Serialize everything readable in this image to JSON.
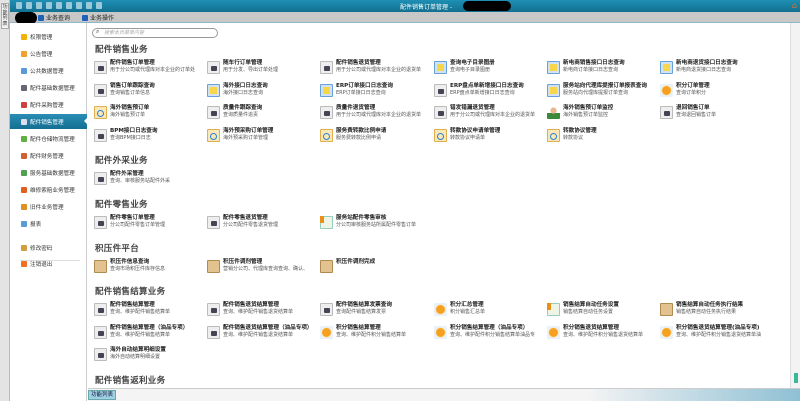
{
  "window": {
    "title": "配件销售订单管理 -",
    "left_strip_label": "功能列表"
  },
  "tabs": [
    "业务查询",
    "业务操作"
  ],
  "sidebar": {
    "items": [
      {
        "label": "权限管理",
        "color": "#f0b400"
      },
      {
        "label": "公告管理",
        "color": "#f0a030"
      },
      {
        "label": "公共数据管理",
        "color": "#5a9ad8"
      },
      {
        "label": "配件基础数据管理",
        "color": "#667"
      },
      {
        "label": "配件采购管理",
        "color": "#d04040"
      },
      {
        "label": "配件销售管理",
        "color": "#dde"
      },
      {
        "label": "配件仓储物流管理",
        "color": "#60b040"
      },
      {
        "label": "配件财务管理",
        "color": "#d06030"
      },
      {
        "label": "服务基础数据管理",
        "color": "#50a050"
      },
      {
        "label": "维修索赔业务管理",
        "color": "#e06020"
      },
      {
        "label": "旧件业务管理",
        "color": "#e09020"
      },
      {
        "label": "报表",
        "color": "#5a9ad8"
      }
    ],
    "footer": [
      {
        "label": "修改密码",
        "color": "#d0a040"
      },
      {
        "label": "注销退出",
        "color": "#f07020"
      }
    ]
  },
  "search": {
    "placeholder": "搜索本页菜单内容"
  },
  "sections": [
    {
      "title": "配件销售业务",
      "items": [
        {
          "t": "配件销售订单管理",
          "d": "用于分公司或代理库对本企业的订单处",
          "i": "doc"
        },
        {
          "t": "随车行订单管理",
          "d": "用于分发、导出订单处理",
          "i": "doc"
        },
        {
          "t": "配件销售退货管理",
          "d": "用于分公司或代理库对本企业的退货单",
          "i": "doc"
        },
        {
          "t": "查询电子目录图册",
          "d": "查询电子目录图册",
          "i": "win"
        },
        {
          "t": "新电商销售接口日志查询",
          "d": "新电商订单接口日志查询",
          "i": "win"
        },
        {
          "t": "新电商退货接口日志查询",
          "d": "新电商退货接口日志查询",
          "i": "win"
        },
        {
          "t": "销售订单跟踪查询",
          "d": "查询销售订单信息",
          "i": "doc"
        },
        {
          "t": "海外接口日志查询",
          "d": "海外接口日志查询",
          "i": "win"
        },
        {
          "t": "ERP订单接口日志查询",
          "d": "ERP订单接口日志查询",
          "i": "win"
        },
        {
          "t": "ERP盘点单新增接口日志查询",
          "d": "ERP盘点单新增接口日志查询",
          "i": "doc"
        },
        {
          "t": "服务站向代理库提报订单报表查询",
          "d": "服务站向代理库提报订单查询",
          "i": "win"
        },
        {
          "t": "积分订单管理",
          "d": "查询订单积分",
          "i": "badge"
        },
        {
          "t": "海外销售预订单",
          "d": "海外销售预订单",
          "i": "mail"
        },
        {
          "t": "质量件跟踪查询",
          "d": "查询质量件追责",
          "i": "doc"
        },
        {
          "t": "质量件退货管理",
          "d": "用于分公司或代理库对本企业的退货单",
          "i": "doc"
        },
        {
          "t": "错发错漏退货管理",
          "d": "用于分公司或代理库对本企业的退货单",
          "i": "doc"
        },
        {
          "t": "海外销售预订单监控",
          "d": "海外销售预订单监控",
          "i": "user"
        },
        {
          "t": "退回销售订单",
          "d": "查询退回销售订单",
          "i": "doc"
        },
        {
          "t": "BPM接口日志查询",
          "d": "查询BPM接口日志",
          "i": "doc"
        },
        {
          "t": "海外预采购订单管理",
          "d": "海外预采购订单管理",
          "i": "mail"
        },
        {
          "t": "服务费转款比例申请",
          "d": "服务费转款比例申请",
          "i": "mail"
        },
        {
          "t": "转款协议申请单管理",
          "d": "转款协议申请单",
          "i": "mail"
        },
        {
          "t": "转款协议管理",
          "d": "转款协议",
          "i": "mail"
        }
      ]
    },
    {
      "title": "配件外采业务",
      "items": [
        {
          "t": "配件外采管理",
          "d": "查询、审核服务站配件外采",
          "i": "doc"
        }
      ]
    },
    {
      "title": "配件零售业务",
      "items": [
        {
          "t": "配件零售订单管理",
          "d": "分公司配件零售订单管理",
          "i": "doc"
        },
        {
          "t": "配件零售退货管理",
          "d": "分公司配件零售退货管理",
          "i": "doc"
        },
        {
          "t": "服务站配件零售审核",
          "d": "分公司审核服务站所属配件零售订单",
          "i": "key"
        }
      ]
    },
    {
      "title": "积压件平台",
      "items": [
        {
          "t": "积压件信息查询",
          "d": "查询市场积压件库存信息",
          "i": "box"
        },
        {
          "t": "积压件调剂管理",
          "d": "营销分公司、代理库查询查询、确认、",
          "i": "box"
        },
        {
          "t": "积压件调剂完成",
          "d": "",
          "i": "box"
        }
      ]
    },
    {
      "title": "配件销售结算业务",
      "items": [
        {
          "t": "配件销售结算管理",
          "d": "查询、维护配件销售结算单",
          "i": "doc"
        },
        {
          "t": "配件销售退货结算管理",
          "d": "查询、维护配件销售退货结算单",
          "i": "doc"
        },
        {
          "t": "配件销售结算发票查询",
          "d": "查询配件销售结算发票",
          "i": "doc"
        },
        {
          "t": "积分汇总管理",
          "d": "积分销售汇总单",
          "i": "badge"
        },
        {
          "t": "销售结算自动任务设置",
          "d": "销售结算自动任务设置",
          "i": "key"
        },
        {
          "t": "销售结算自动任务执行结果",
          "d": "销售结算自动任务执行结果",
          "i": "box"
        },
        {
          "t": "配件销售结算管理（油品专项）",
          "d": "查询、维护配件销售结算单",
          "i": "doc"
        },
        {
          "t": "配件销售退货结算管理（油品专项）",
          "d": "查询、维护配件销售退货结算单",
          "i": "doc"
        },
        {
          "t": "积分销售结算管理",
          "d": "查询、维护配件积分销售结算单",
          "i": "badge"
        },
        {
          "t": "积分销售结算管理（油品专项）",
          "d": "查询、维护配件积分销售结算单油品专",
          "i": "badge"
        },
        {
          "t": "积分销售退货结算管理",
          "d": "查询、维护配件积分销售退货结算单",
          "i": "badge"
        },
        {
          "t": "积分销售退货结算管理(油品专项)",
          "d": "查询、维护配件积分销售退货结算单油",
          "i": "badge"
        },
        {
          "t": "海外自动结算明细设置",
          "d": "海外自动结算明细设置",
          "i": "doc"
        }
      ]
    },
    {
      "title": "配件销售返利业务",
      "items": []
    }
  ],
  "bottom_tab": "功能列表"
}
